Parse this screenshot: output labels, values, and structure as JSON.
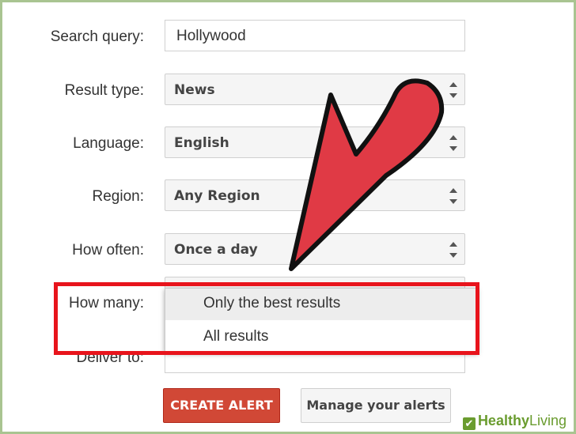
{
  "form": {
    "search_query": {
      "label": "Search query:",
      "value": "Hollywood"
    },
    "result_type": {
      "label": "Result type:",
      "value": "News"
    },
    "language": {
      "label": "Language:",
      "value": "English"
    },
    "region": {
      "label": "Region:",
      "value": "Any Region"
    },
    "how_often": {
      "label": "How often:",
      "value": "Once a day"
    },
    "how_many": {
      "label": "How many:",
      "options": [
        "Only the best results",
        "All results"
      ],
      "selected": "Only the best results"
    },
    "deliver_to": {
      "label": "Deliver to:"
    }
  },
  "buttons": {
    "create_alert": "CREATE ALERT",
    "manage_alerts": "Manage your alerts"
  },
  "watermark": {
    "icon": "✔",
    "part1": "Healthy",
    "part2": "Living"
  },
  "colors": {
    "arrow": "#e03a45",
    "highlight": "#e8141c",
    "primary": "#d14836",
    "frame": "#a9c491"
  }
}
